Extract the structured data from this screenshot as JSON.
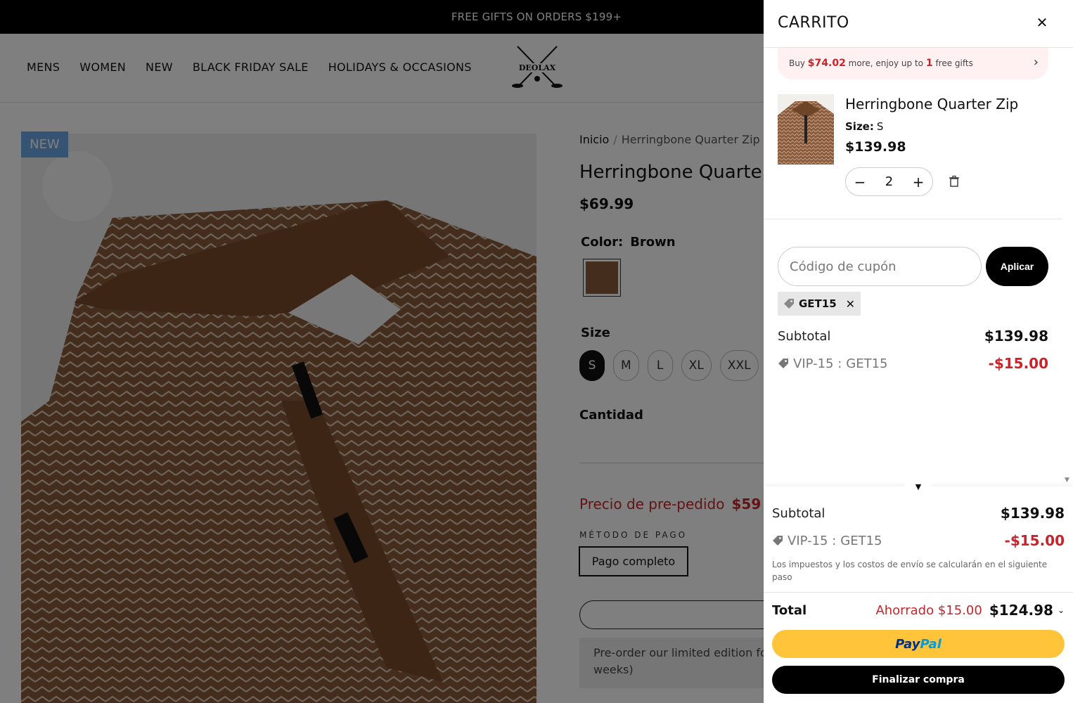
{
  "announcement": "FREE GIFTS ON ORDERS $199+",
  "nav": [
    "MENS",
    "WOMEN",
    "NEW",
    "BLACK FRIDAY SALE",
    "HOLIDAYS & OCCASIONS"
  ],
  "logo_text": "DEOLAX",
  "badge": "NEW",
  "breadcrumb": {
    "home": "Inicio",
    "sep": "/",
    "current": "Herringbone Quarter Zip"
  },
  "product": {
    "title": "Herringbone Quarte",
    "price": "$69.99",
    "color_label": "Color:",
    "color_value": "Brown",
    "size_label": "Size",
    "sizes": [
      "S",
      "M",
      "L",
      "XL",
      "XXL"
    ],
    "qty_label": "Cantidad",
    "preorder_label": "Precio de pre-pedido",
    "preorder_price": "$59",
    "pay_method_label": "MÉTODO DE PAGO",
    "pay_full": "Pago completo",
    "preorder_note": "Pre-order our limited edition fo weeks)"
  },
  "cart": {
    "title": "CARRITO",
    "gift_bar": {
      "pre": "Buy",
      "amount": "$74.02",
      "mid": "more, enjoy up to",
      "count": "1",
      "post": "free gifts"
    },
    "item": {
      "name": "Herringbone Quarter Zip",
      "size_label": "Size:",
      "size_value": "S",
      "price": "$139.98",
      "qty": "2"
    },
    "coupon_placeholder": "Código de cupón",
    "apply": "Aplicar",
    "applied_code": "GET15",
    "subtotal_label": "Subtotal",
    "subtotal": "$139.98",
    "discount_label": "VIP-15 :",
    "discount_code": "GET15",
    "discount": "-$15.00",
    "tax_note": "Los impuestos y los costos de envío se calcularán en el siguiente paso",
    "total_label": "Total",
    "saved": "Ahorrado $15.00",
    "total": "$124.98",
    "paypal_pay": "Pay",
    "paypal_pal": "Pal",
    "checkout": "Finalizar compra"
  },
  "colors": {
    "accent_red": "#c8242a",
    "paypal_yellow": "#ffc439",
    "badge_blue": "#6aa8e8",
    "product_brown": "#8a5a3c"
  }
}
